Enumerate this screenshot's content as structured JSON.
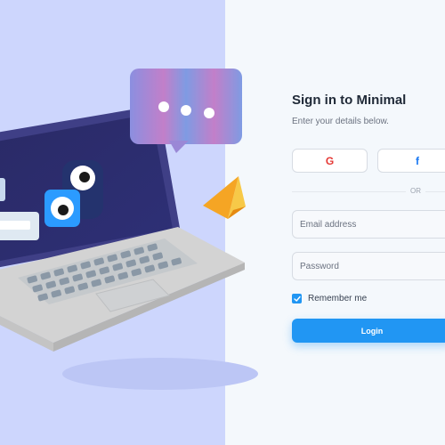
{
  "form": {
    "title": "Sign in to Minimal",
    "subtitle": "Enter your details below.",
    "google_icon": "G",
    "facebook_icon": "f",
    "divider_text": "OR",
    "email_placeholder": "Email address",
    "password_placeholder": "Password",
    "remember_label": "Remember me",
    "remember_checked": true,
    "login_label": "Login"
  },
  "illustration": {
    "icons": [
      "laptop-icon",
      "chat-bubble-icon",
      "paper-plane-icon",
      "monster-character-icon"
    ]
  },
  "colors": {
    "left_background": "#cdd6fd",
    "right_background": "#f4f8fc",
    "accent": "#2196f3",
    "google_red": "#e53935",
    "facebook_blue": "#1877f2"
  }
}
